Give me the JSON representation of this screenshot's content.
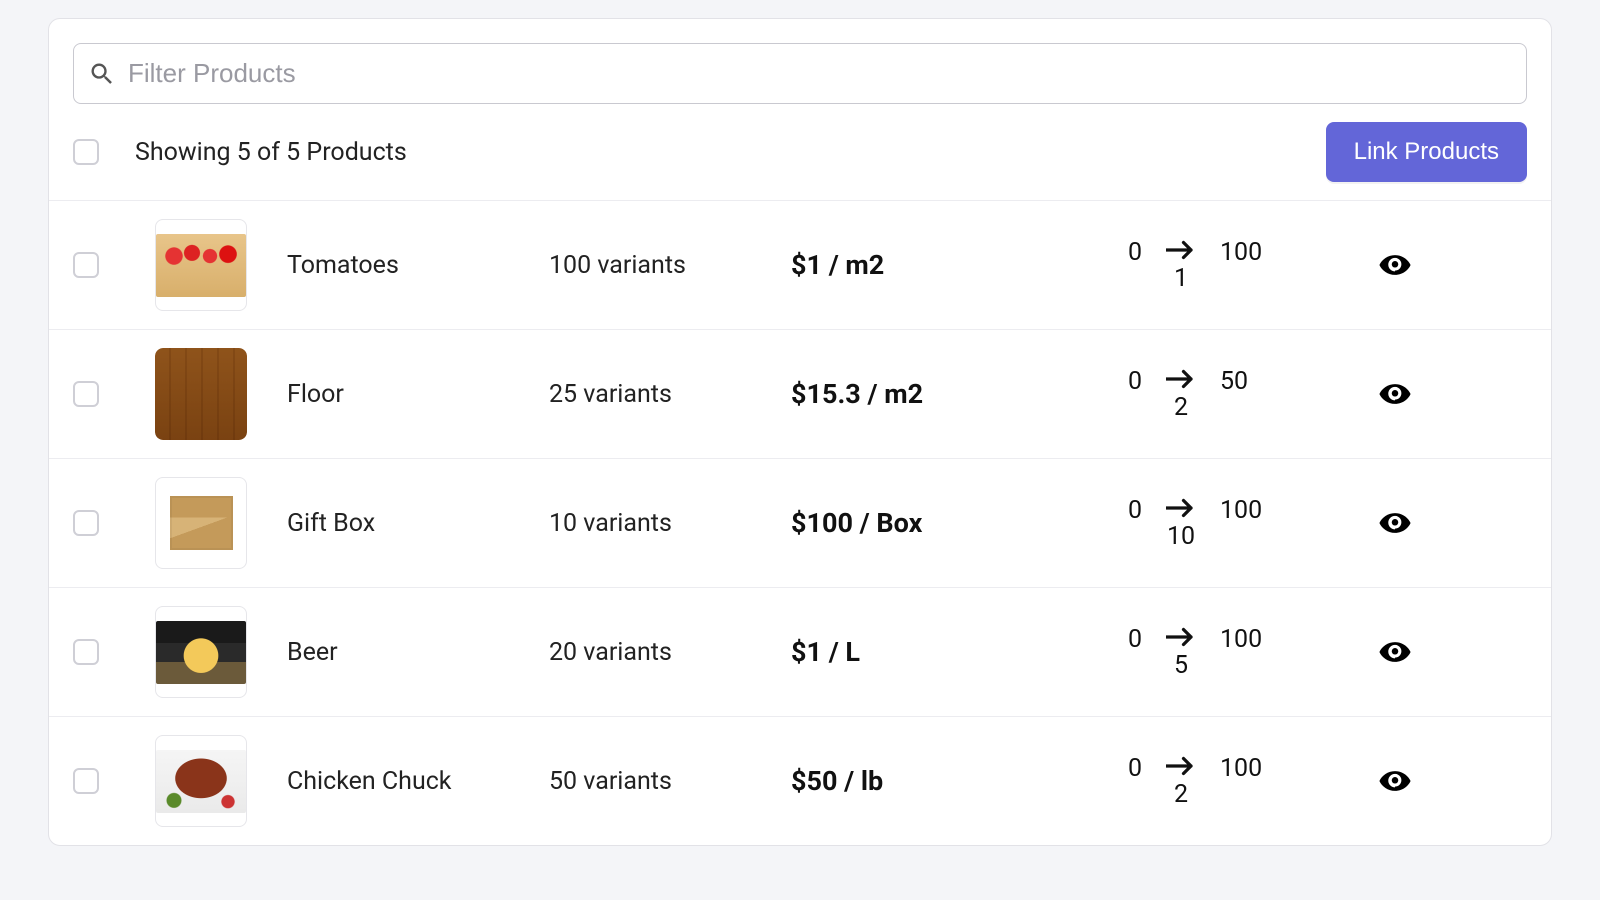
{
  "search": {
    "placeholder": "Filter Products"
  },
  "header": {
    "showing": "Showing 5 of 5 Products",
    "link_button": "Link Products"
  },
  "products": [
    {
      "name": "Tomatoes",
      "variants": "100 variants",
      "price": "$1 / m2",
      "from": "0",
      "step": "1",
      "to": "100",
      "thumb": "tomatoes",
      "border": true
    },
    {
      "name": "Floor",
      "variants": "25 variants",
      "price": "$15.3 / m2",
      "from": "0",
      "step": "2",
      "to": "50",
      "thumb": "floor",
      "border": false
    },
    {
      "name": "Gift Box",
      "variants": "10 variants",
      "price": "$100 / Box",
      "from": "0",
      "step": "10",
      "to": "100",
      "thumb": "box",
      "border": true
    },
    {
      "name": "Beer",
      "variants": "20 variants",
      "price": "$1 / L",
      "from": "0",
      "step": "5",
      "to": "100",
      "thumb": "beer",
      "border": true
    },
    {
      "name": "Chicken Chuck",
      "variants": "50 variants",
      "price": "$50 / lb",
      "from": "0",
      "step": "2",
      "to": "100",
      "thumb": "chicken",
      "border": true
    }
  ]
}
